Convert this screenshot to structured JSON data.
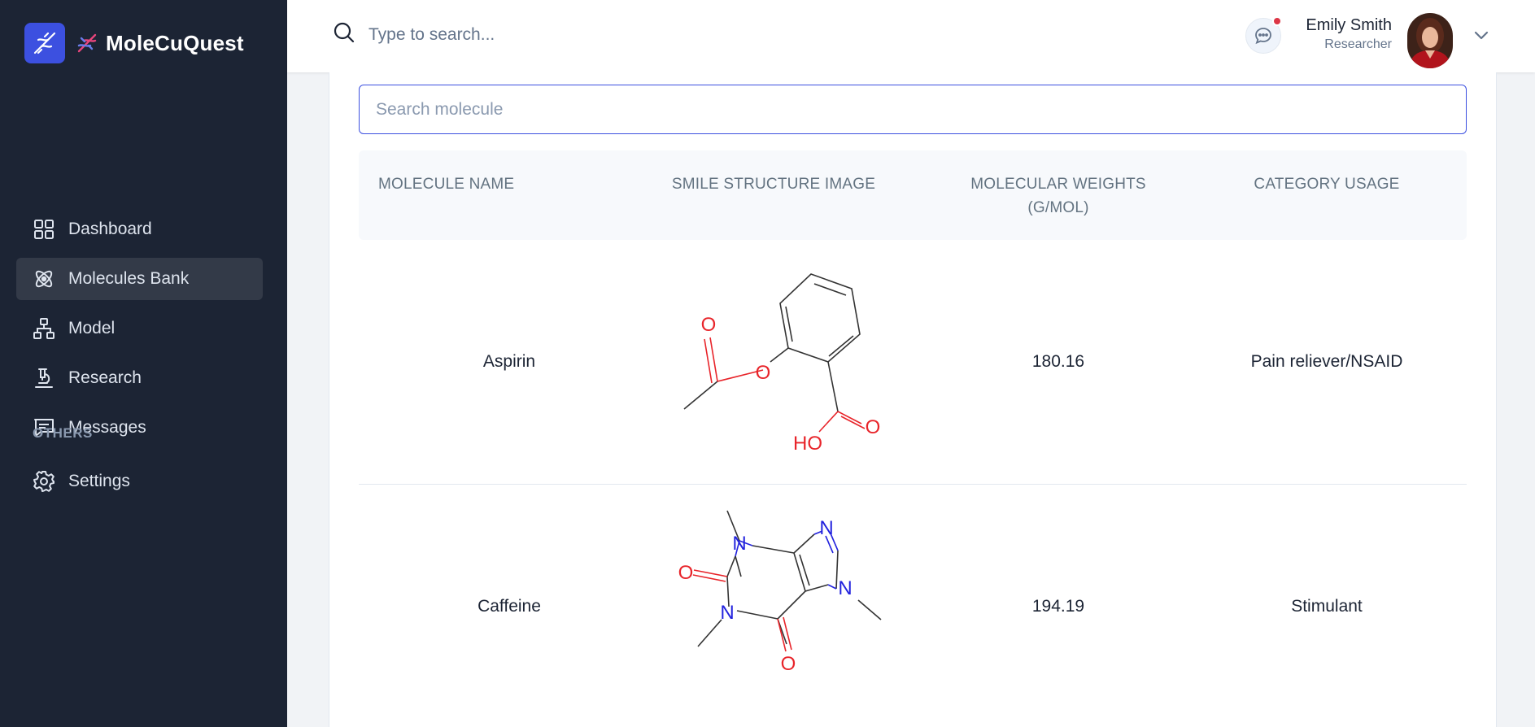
{
  "brand": {
    "name": "MoleCuQuest"
  },
  "sidebar": {
    "items": [
      {
        "label": "Dashboard",
        "icon": "grid-icon"
      },
      {
        "label": "Molecules Bank",
        "icon": "atom-icon",
        "active": true
      },
      {
        "label": "Model",
        "icon": "network-icon"
      },
      {
        "label": "Research",
        "icon": "microscope-icon"
      },
      {
        "label": "Messages",
        "icon": "message-icon"
      }
    ],
    "section_label": "OTHERS",
    "settings": {
      "label": "Settings",
      "icon": "gear-icon"
    }
  },
  "header": {
    "search_placeholder": "Type to search...",
    "user": {
      "name": "Emily Smith",
      "role": "Researcher"
    },
    "has_notification": true
  },
  "main": {
    "search_placeholder": "Search molecule",
    "columns": [
      "MOLECULE NAME",
      "SMILE STRUCTURE IMAGE",
      "MOLECULAR WEIGHTS (G/MOL)",
      "CATEGORY USAGE"
    ],
    "rows": [
      {
        "name": "Aspirin",
        "weight": "180.16",
        "category": "Pain reliever/NSAID",
        "atom_labels": {
          "o_carbonyl": "O",
          "o_ester": "O",
          "o_acid": "O",
          "oh": "HO"
        }
      },
      {
        "name": "Caffeine",
        "weight": "194.19",
        "category": "Stimulant",
        "atom_labels": {
          "n1": "N",
          "n2": "N",
          "n3": "N",
          "n4": "N",
          "o1": "O",
          "o2": "O"
        }
      }
    ]
  },
  "colors": {
    "sidebar_bg": "#1c2434",
    "accent": "#3c50e0",
    "oxygen": "#e8242a",
    "nitrogen": "#2222dd"
  }
}
